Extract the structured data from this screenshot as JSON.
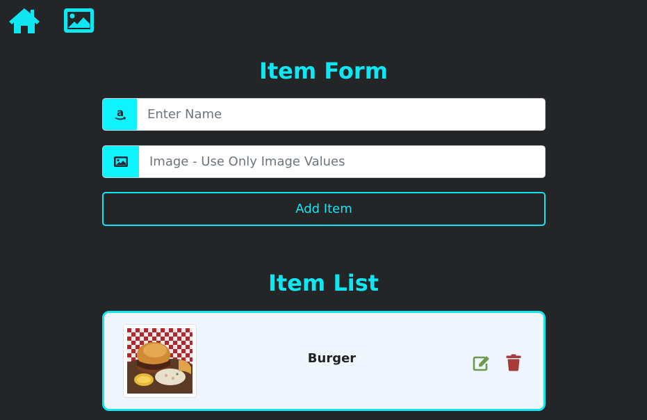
{
  "nav": {
    "home_icon": "home-icon",
    "gallery_icon": "image-icon"
  },
  "form": {
    "title": "Item Form",
    "name_icon": "amazon-icon",
    "name_placeholder": "Enter Name",
    "name_value": "",
    "image_icon": "image-icon",
    "image_placeholder": "Image - Use Only Image Values",
    "image_value": "",
    "add_button_label": "Add Item"
  },
  "list": {
    "title": "Item List",
    "items": [
      {
        "name": "Burger",
        "image_description_icon": "burger-photo",
        "edit_icon": "edit-icon",
        "delete_icon": "trash-icon"
      }
    ]
  },
  "colors": {
    "background": "#242527",
    "accent": "#10e6f2",
    "addon": "#0ff3ff",
    "card": "#eff6fd",
    "edit": "#6a9a4a",
    "delete": "#a83a3a"
  }
}
